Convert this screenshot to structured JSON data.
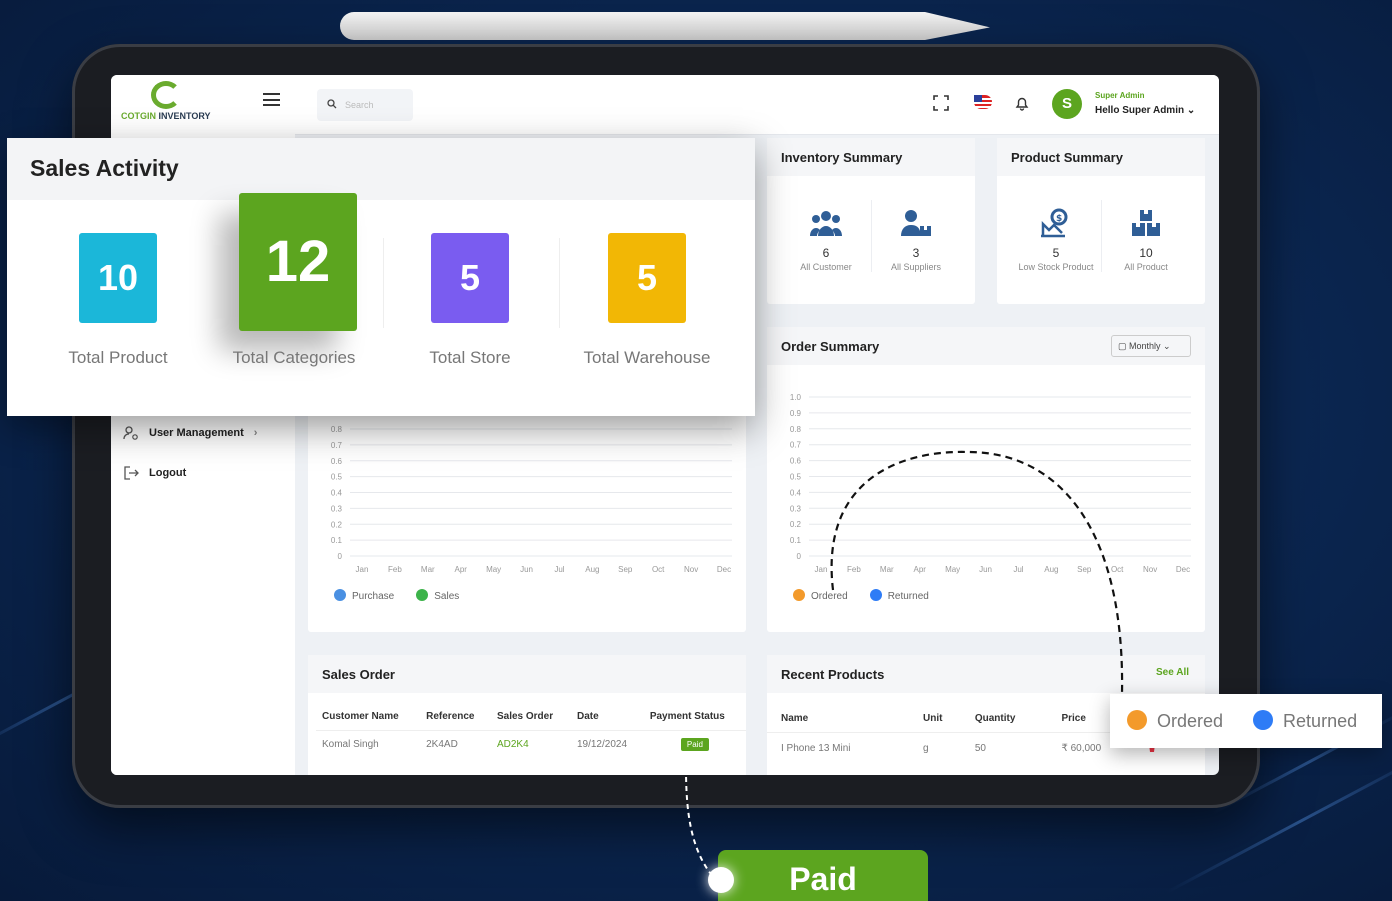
{
  "app": {
    "logo_prefix": "COTGIN",
    "logo_suffix": "INVENTORY"
  },
  "sidebar": {
    "items": [
      {
        "label": "User Management",
        "icon": "user-gear-icon",
        "chevron": "›"
      },
      {
        "label": "Logout",
        "icon": "logout-icon"
      }
    ]
  },
  "topbar": {
    "search_placeholder": "Search",
    "icons": [
      "fullscreen-icon",
      "us-flag-icon",
      "bell-icon"
    ],
    "avatar_initial": "S",
    "user_role": "Super Admin",
    "user_greeting": "Hello Super Admin ⌄"
  },
  "sales_activity": {
    "title": "Sales Activity",
    "tiles": [
      {
        "value": "10",
        "label": "Total Product",
        "color": "#1bb7d9"
      },
      {
        "value": "12",
        "label": "Total Categories",
        "color": "#5ca51f"
      },
      {
        "value": "5",
        "label": "Total Store",
        "color": "#7a5cf0"
      },
      {
        "value": "5",
        "label": "Total Warehouse",
        "color": "#f2b705"
      }
    ]
  },
  "inventory_summary": {
    "title": "Inventory Summary",
    "items": [
      {
        "value": "6",
        "label": "All Customer",
        "icon": "customers-icon"
      },
      {
        "value": "3",
        "label": "All Suppliers",
        "icon": "suppliers-icon"
      }
    ]
  },
  "product_summary": {
    "title": "Product Summary",
    "items": [
      {
        "value": "5",
        "label": "Low Stock Product",
        "icon": "low-stock-icon"
      },
      {
        "value": "10",
        "label": "All Product",
        "icon": "boxes-icon"
      }
    ]
  },
  "order_summary": {
    "title": "Order Summary",
    "filter": "Monthly ⌄"
  },
  "chart_data": [
    {
      "type": "line",
      "x": [
        "Jan",
        "Feb",
        "Mar",
        "Apr",
        "May",
        "Jun",
        "Jul",
        "Aug",
        "Sep",
        "Oct",
        "Nov",
        "Dec"
      ],
      "y_ticks": [
        "0",
        "0.1",
        "0.2",
        "0.3",
        "0.4",
        "0.5",
        "0.6",
        "0.7",
        "0.8"
      ],
      "ylim": [
        0,
        0.8
      ],
      "series": [
        {
          "name": "Purchase",
          "color": "#4a90e2",
          "values": []
        },
        {
          "name": "Sales",
          "color": "#3cb34a",
          "values": []
        }
      ],
      "grid": true,
      "legend": "bottom-left"
    },
    {
      "type": "line",
      "x": [
        "Jan",
        "Feb",
        "Mar",
        "Apr",
        "May",
        "Jun",
        "Jul",
        "Aug",
        "Sep",
        "Oct",
        "Nov",
        "Dec"
      ],
      "y_ticks": [
        "0",
        "0.1",
        "0.2",
        "0.3",
        "0.4",
        "0.5",
        "0.6",
        "0.7",
        "0.8",
        "0.9",
        "1.0"
      ],
      "ylim": [
        0,
        1.0
      ],
      "series": [
        {
          "name": "Ordered",
          "color": "#f39a2b",
          "values": []
        },
        {
          "name": "Returned",
          "color": "#2e7cf6",
          "values": []
        }
      ],
      "grid": true,
      "legend": "bottom-left"
    }
  ],
  "sales_order": {
    "title": "Sales Order",
    "columns": [
      "Customer Name",
      "Reference",
      "Sales Order",
      "Date",
      "Payment Status"
    ],
    "rows": [
      {
        "customer": "Komal Singh",
        "reference": "2K4AD",
        "order": "AD2K4",
        "date": "19/12/2024",
        "status": "Paid"
      }
    ]
  },
  "recent_products": {
    "title": "Recent Products",
    "see_all": "See All",
    "columns": [
      "Name",
      "Unit",
      "Quantity",
      "Price"
    ],
    "rows": [
      {
        "name": "I Phone 13 Mini",
        "unit": "g",
        "quantity": "50",
        "price": "₹ 60,000"
      }
    ]
  },
  "callouts": {
    "legend_ordered": "Ordered",
    "legend_returned": "Returned",
    "paid": "Paid"
  }
}
